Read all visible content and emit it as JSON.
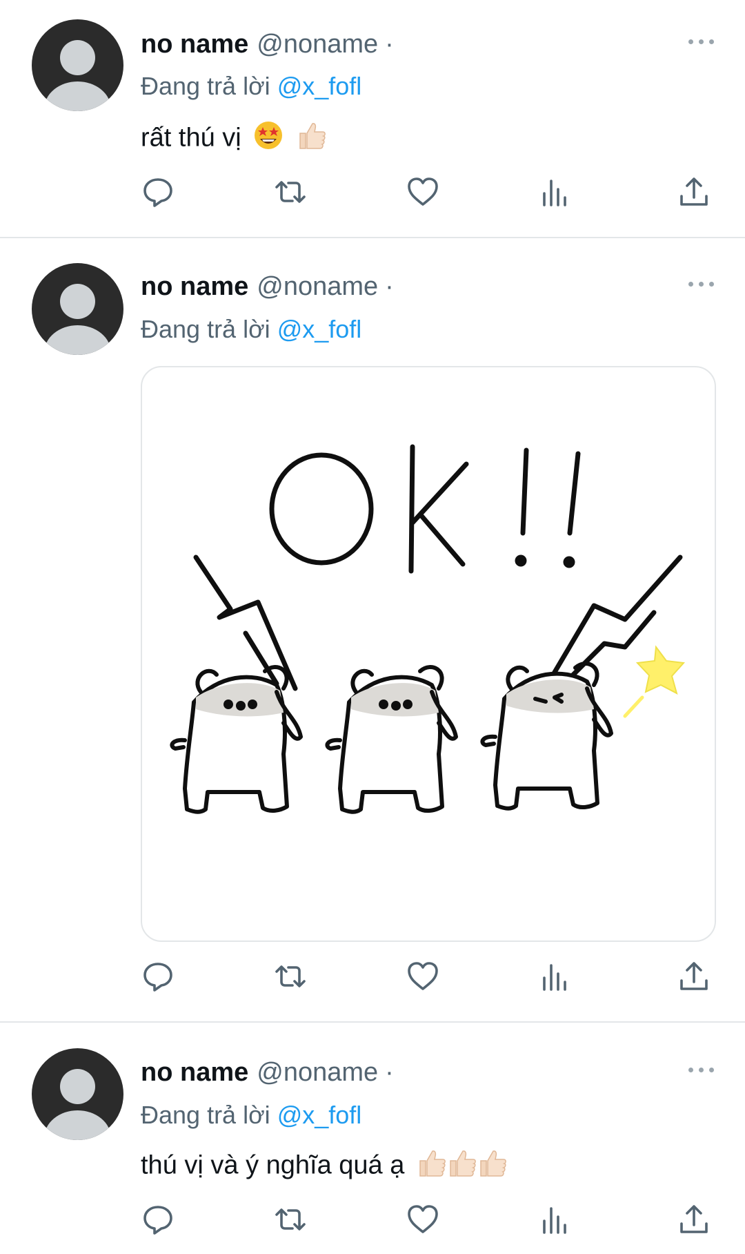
{
  "tweets": [
    {
      "name": "no name",
      "handle": "@noname",
      "separator": "·",
      "reply_prefix": "Đang trả lời",
      "reply_to": "@x_fofl",
      "text": "rất thú vị",
      "emojis": [
        "star-struck-emoji",
        "thumbs-up-emoji"
      ]
    },
    {
      "name": "no name",
      "handle": "@noname",
      "separator": "·",
      "reply_prefix": "Đang trả lời",
      "reply_to": "@x_fofl",
      "media": {
        "sticker_text": "OK!!",
        "description_icon": "three-hamsters-saluting-sticker"
      }
    },
    {
      "name": "no name",
      "handle": "@noname",
      "separator": "·",
      "reply_prefix": "Đang trả lời",
      "reply_to": "@x_fofl",
      "text": "thú vị và ý nghĩa quá ạ",
      "emojis": [
        "thumbs-up-emoji",
        "thumbs-up-emoji",
        "thumbs-up-emoji"
      ]
    }
  ],
  "action_icons": [
    "reply-icon",
    "retweet-icon",
    "like-icon",
    "views-icon",
    "share-icon"
  ],
  "colors": {
    "text": "#0f1419",
    "secondary": "#536471",
    "mention": "#1d9bf0",
    "icon": "#536471",
    "divider": "#e3e6e8"
  }
}
